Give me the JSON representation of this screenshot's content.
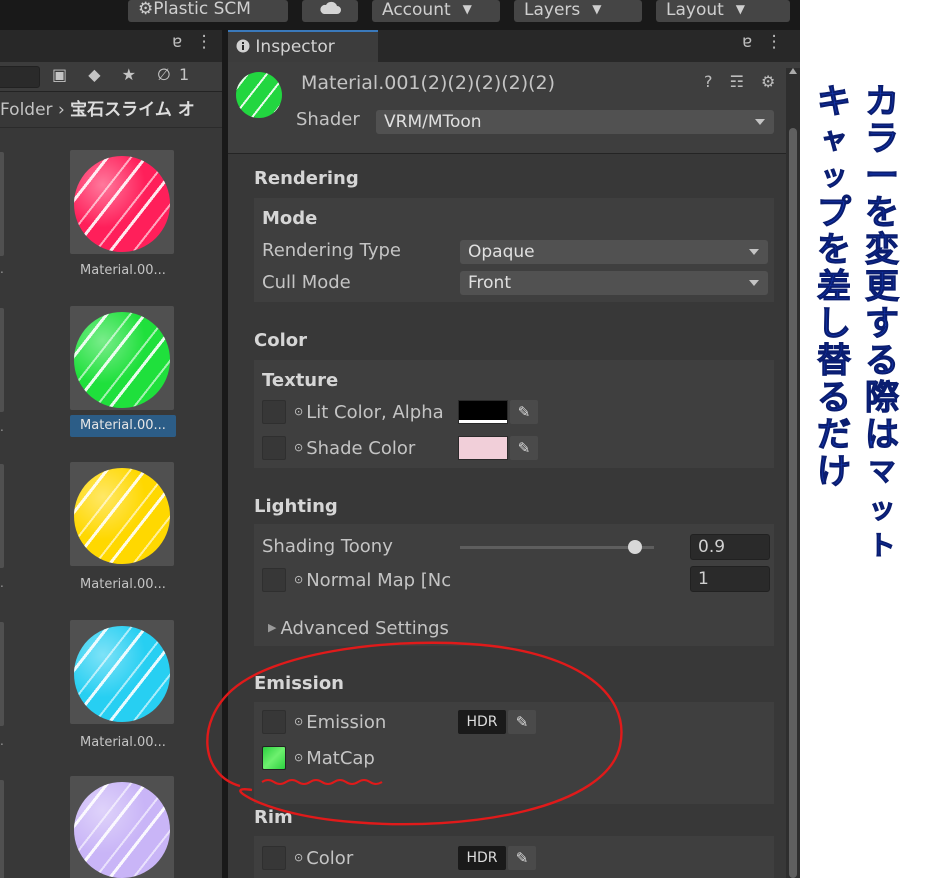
{
  "toolbar": {
    "plastic_scm": "⚙Plastic SCM",
    "cloud_icon": "cloud-icon",
    "account": "Account",
    "layers": "Layers",
    "layout": "Layout"
  },
  "project": {
    "tab_icons": "ɐ ⋮",
    "toolbar_icons": "▣ ◆ ★ ∅1",
    "breadcrumb_folder": "Folder",
    "breadcrumb_sep": "›",
    "breadcrumb_current": "宝石スライム オ",
    "items": [
      {
        "label": "Material.00...",
        "color": "#ff1f5a"
      },
      {
        "label": "Material.00...",
        "color": "#1fe03c"
      },
      {
        "label": "Material.00...",
        "color": "#ffd800"
      },
      {
        "label": "Material.00...",
        "color": "#27cff2"
      },
      {
        "label": "",
        "color": "#c9b5f7"
      }
    ]
  },
  "inspector": {
    "tab_label": "Inspector",
    "tab_icon": "info-icon",
    "tab_right_icons": "ɐ ⋮",
    "material_name": "Material.001(2)(2)(2)(2)(2)",
    "header_icons": "? ☶ ⚙",
    "shader_label": "Shader",
    "shader_value": "VRM/MToon",
    "rendering": {
      "title": "Rendering",
      "mode_title": "Mode",
      "rendering_type_label": "Rendering Type",
      "rendering_type_value": "Opaque",
      "cull_mode_label": "Cull Mode",
      "cull_mode_value": "Front"
    },
    "color": {
      "title": "Color",
      "texture_title": "Texture",
      "lit_color_label": "Lit Color, Alpha",
      "lit_color_value": "#000000",
      "shade_color_label": "Shade Color",
      "shade_color_value": "#f1cfd9"
    },
    "lighting": {
      "title": "Lighting",
      "shading_toony_label": "Shading Toony",
      "shading_toony_value": "0.9",
      "normal_map_label": "Normal Map [Nc",
      "normal_map_value": "1",
      "advanced_label": "Advanced Settings"
    },
    "emission": {
      "title": "Emission",
      "emission_label": "Emission",
      "hdr_label": "HDR",
      "matcap_label": "MatCap"
    },
    "rim": {
      "title": "Rim",
      "color_label": "Color",
      "hdr_label": "HDR"
    }
  },
  "annotation": {
    "column_1": [
      "カ",
      "ラ",
      "ー",
      "を",
      "変",
      "更",
      "す",
      "る",
      "際",
      "は",
      "マ",
      "ッ",
      "ト"
    ],
    "column_2": [
      "キ",
      "ャ",
      "ッ",
      "プ",
      "を",
      "差",
      "し",
      "替",
      "る",
      "だ",
      "け"
    ],
    "circle_color": "#e01a1a",
    "text_color": "#1438b4"
  }
}
